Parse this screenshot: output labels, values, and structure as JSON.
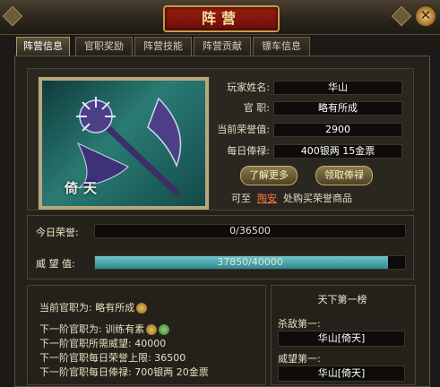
{
  "window": {
    "title": "阵营",
    "close_label": "✕"
  },
  "tabs": [
    {
      "label": "阵营信息",
      "active": true
    },
    {
      "label": "官职奖励",
      "active": false
    },
    {
      "label": "阵营技能",
      "active": false
    },
    {
      "label": "阵营贡献",
      "active": false
    },
    {
      "label": "镖车信息",
      "active": false
    }
  ],
  "emblem": {
    "text": "倚天",
    "icon": "sword-emblem-icon"
  },
  "info": {
    "player_name_label": "玩家姓名:",
    "player_name": "华山",
    "official_label": "官    职:",
    "official": "略有所成",
    "honor_label": "当前荣誉值:",
    "honor": "2900",
    "salary_label": "每日俸禄:",
    "salary": "400银两 15金票"
  },
  "buttons": {
    "learn_more": "了解更多",
    "claim_salary": "领取俸禄"
  },
  "shop": {
    "prefix": "可至",
    "link": "陶安",
    "suffix": "处购买荣誉商品"
  },
  "bars": {
    "today_honor_label": "今日荣誉:",
    "today_honor_text": "0/36500",
    "today_honor_fraction": 0,
    "prestige_label": "威 望 值:",
    "prestige_text": "37850/40000",
    "prestige_fraction": 0.946
  },
  "rank": {
    "current_label": "当前官职为: 略有所成",
    "next_label": "下一阶官职为: 训练有素",
    "need_prestige": "下一阶官职所需威望: 40000",
    "daily_honor_cap": "下一阶官职每日荣誉上限: 36500",
    "daily_salary": "下一阶官职每日俸禄: 700银两 20金票"
  },
  "leaderboard": {
    "title": "天下第一榜",
    "kill_label": "杀敌第一:",
    "kill_value": "华山[倚天]",
    "prestige_label": "威望第一:",
    "prestige_value": "华山[倚天]"
  },
  "colors": {
    "accent": "#c89a48",
    "link": "#ff7a3a",
    "prestige_bar": "#4aa7ad"
  }
}
